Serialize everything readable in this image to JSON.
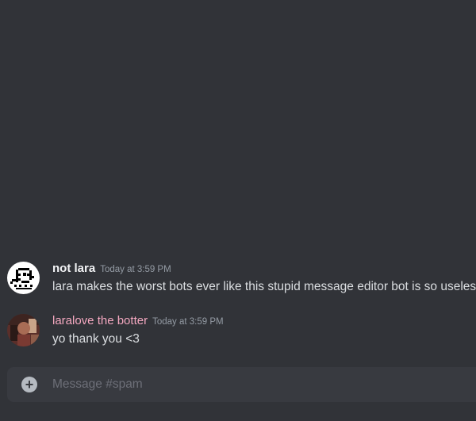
{
  "messages": [
    {
      "author": "not lara",
      "timestamp": "Today at 3:59 PM",
      "text": "lara makes the worst bots ever like this stupid message editor bot is so useless",
      "author_color": "#f2f3f5",
      "avatar_icon": "pixel-face-avatar"
    },
    {
      "author": "laralove the botter",
      "timestamp": "Today at 3:59 PM",
      "text": "yo thank you <3",
      "author_color": "#f4a8c0",
      "avatar_icon": "photo-avatar"
    }
  ],
  "composer": {
    "placeholder": "Message #spam",
    "attach_icon": "plus-circle-icon"
  },
  "colors": {
    "background": "#313338",
    "composer_background": "#383a40",
    "text": "#dbdee1",
    "muted": "#949ba4"
  }
}
